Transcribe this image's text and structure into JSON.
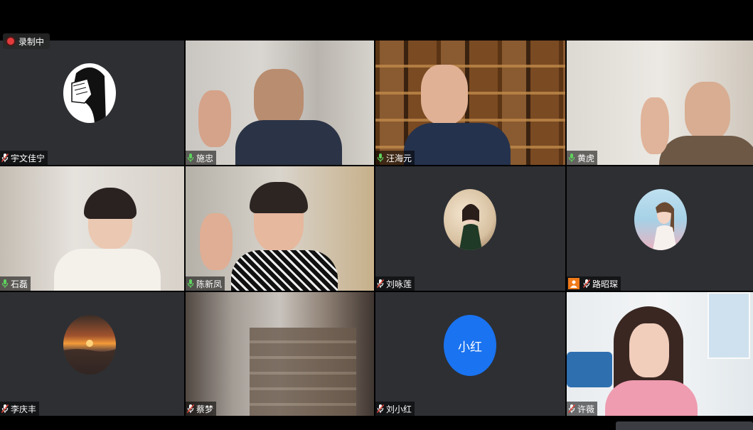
{
  "recording": {
    "label": "录制中"
  },
  "participants": [
    {
      "name": "宇文佳宁",
      "mic": "muted"
    },
    {
      "name": "施忠",
      "mic": "on"
    },
    {
      "name": "汪海元",
      "mic": "on"
    },
    {
      "name": "黄虎",
      "mic": "on"
    },
    {
      "name": "石磊",
      "mic": "on"
    },
    {
      "name": "陈新凤",
      "mic": "on"
    },
    {
      "name": "刘咏莲",
      "mic": "muted"
    },
    {
      "name": "路昭琛",
      "mic": "muted"
    },
    {
      "name": "李庆丰",
      "mic": "muted"
    },
    {
      "name": "蔡梦",
      "mic": "muted"
    },
    {
      "name": "刘小红",
      "mic": "muted"
    },
    {
      "name": "许薇",
      "mic": "muted"
    }
  ],
  "avatar_initials": {
    "liu_xiaohong": "小红"
  },
  "colors": {
    "muted_mic": "#e0453a",
    "on_mic": "#5ed35e",
    "avatar_blue": "#1a73f0",
    "tile_bg": "#2d2f33"
  }
}
